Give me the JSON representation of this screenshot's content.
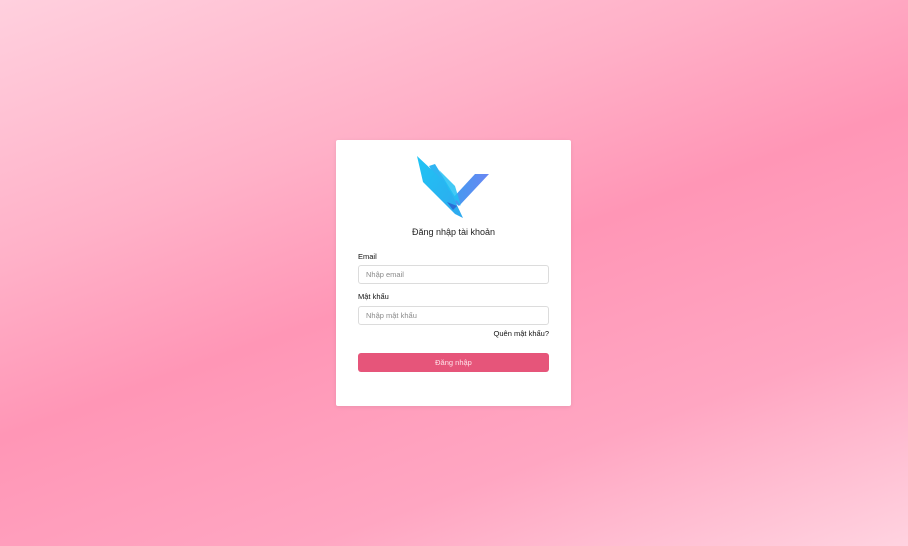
{
  "login": {
    "title": "Đăng nhập tài khoản",
    "email_label": "Email",
    "email_placeholder": "Nhập email",
    "email_value": "",
    "password_label": "Mật khẩu",
    "password_placeholder": "Nhập mật khẩu",
    "password_value": "",
    "forgot_link": "Quên mật khẩu?",
    "submit_label": "Đăng nhập"
  },
  "logo": {
    "icon": "v-shaped-arrow-logo",
    "colors": [
      "#2fc6f2",
      "#5b8cf0"
    ]
  },
  "colors": {
    "accent": "#e6557a",
    "background": "#ffa6c2",
    "card": "#ffffff"
  }
}
